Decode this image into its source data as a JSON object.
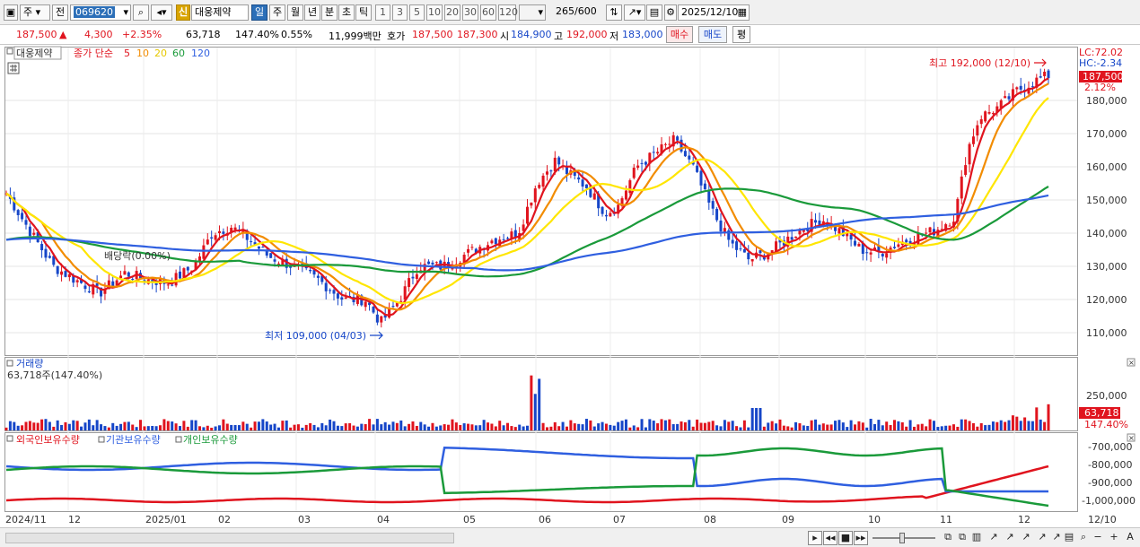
{
  "toolbar": {
    "market": "주",
    "view": "전",
    "code": "069620",
    "badge_shin": "신",
    "stock_name": "대웅제약",
    "periods": [
      "일",
      "주",
      "월",
      "년",
      "분",
      "초",
      "틱"
    ],
    "selected_period": "일",
    "ticks": [
      "1",
      "3",
      "5",
      "10",
      "20",
      "30",
      "60",
      "120"
    ],
    "count": "265",
    "count_total": "/600",
    "date": "2025/12/10"
  },
  "quote": {
    "price": "187,500",
    "arrow": "▲",
    "change": "4,300",
    "change_pct": "+2.35%",
    "volume": "63,718",
    "volume_ratio": "147.40%",
    "turnover": "0.55%",
    "amount": "11,999백만",
    "ask_label": "호가",
    "ask": "187,500",
    "bid": "187,300",
    "open_label": "시",
    "open": "184,900",
    "high_label": "고",
    "high": "192,000",
    "low_label": "저",
    "low": "183,000",
    "buy_label": "매수",
    "sell_label": "매도",
    "avg_label": "평"
  },
  "price_panel": {
    "stock_label": "대웅제약",
    "ma_label": "종가 단순",
    "ma_periods": [
      "5",
      "10",
      "20",
      "60",
      "120"
    ],
    "ma_colors": [
      "#e0141e",
      "#f28c00",
      "#ffe600",
      "#1a9a3a",
      "#2f5fe0"
    ],
    "lc": "LC:72.02",
    "hc": "HC:-2.34",
    "current_price": "187,500",
    "current_pct": "2.12%",
    "high_note": "최고 192,000 (12/10)",
    "low_note": "최저 109,000 (04/03)",
    "dividend_note": "배당락(0.00%)",
    "y_ticks": [
      "180,000",
      "170,000",
      "160,000",
      "150,000",
      "140,000",
      "130,000",
      "120,000",
      "110,000"
    ]
  },
  "volume_panel": {
    "title": "거래량",
    "value_line": "63,718주(147.40%)",
    "y_ticks": [
      "250,000"
    ],
    "current": "63,718",
    "current_pct": "147.40%"
  },
  "holder_panel": {
    "legend": [
      "외국인보유수량",
      "기관보유수량",
      "개인보유수량"
    ],
    "legend_colors": [
      "#e0141e",
      "#2f5fe0",
      "#1a9a3a"
    ],
    "y_ticks": [
      "-700,000",
      "-800,000",
      "-900,000",
      "-1,000,000"
    ]
  },
  "x_axis": {
    "labels": [
      "2024/11",
      "12",
      "2025/01",
      "02",
      "03",
      "04",
      "05",
      "06",
      "07",
      "08",
      "09",
      "10",
      "11",
      "12"
    ],
    "right_label": "12/10"
  }
}
